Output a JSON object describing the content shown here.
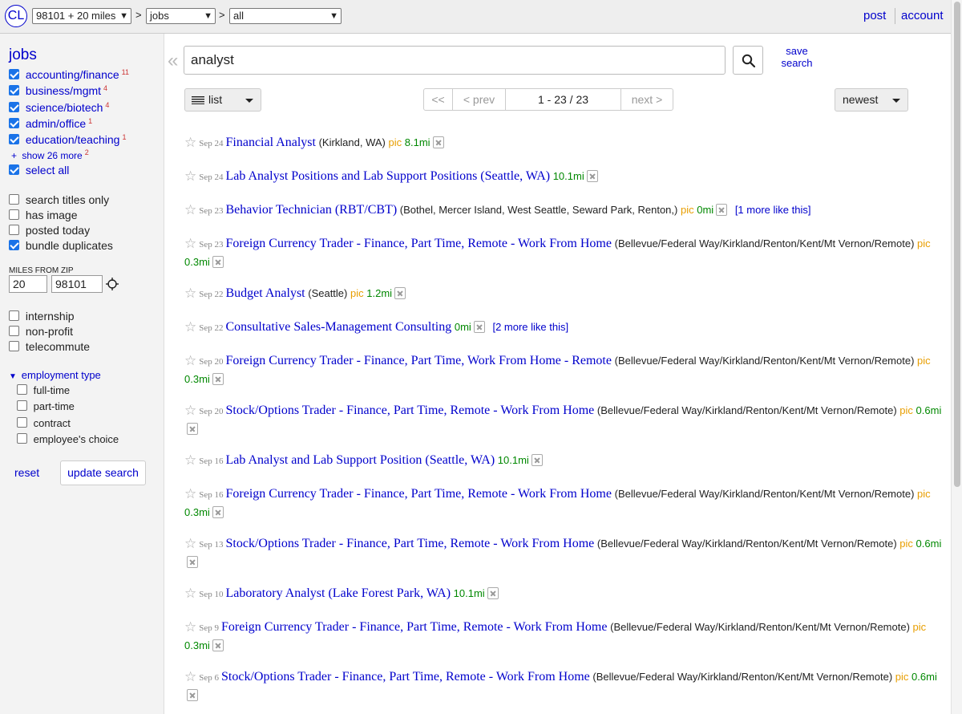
{
  "header": {
    "logo": "CL",
    "location_select": "98101 + 20 miles",
    "category_select": "jobs",
    "subcategory_select": "all",
    "separator": ">",
    "post": "post",
    "account": "account"
  },
  "sidebar": {
    "title": "jobs",
    "categories": [
      {
        "label": "accounting/finance",
        "count": "11",
        "checked": true
      },
      {
        "label": "business/mgmt",
        "count": "4",
        "checked": true
      },
      {
        "label": "science/biotech",
        "count": "4",
        "checked": true
      },
      {
        "label": "admin/office",
        "count": "1",
        "checked": true
      },
      {
        "label": "education/teaching",
        "count": "1",
        "checked": true
      }
    ],
    "show_more": "show 26 more",
    "show_more_count": "2",
    "select_all": "select all",
    "options": [
      {
        "label": "search titles only",
        "checked": false
      },
      {
        "label": "has image",
        "checked": false
      },
      {
        "label": "posted today",
        "checked": false
      },
      {
        "label": "bundle duplicates",
        "checked": true
      }
    ],
    "miles_label": "MILES FROM ZIP",
    "miles_value": "20",
    "zip_value": "98101",
    "extra_filters": [
      {
        "label": "internship",
        "checked": false
      },
      {
        "label": "non-profit",
        "checked": false
      },
      {
        "label": "telecommute",
        "checked": false
      }
    ],
    "employment_type_label": "employment type",
    "employment_types": [
      {
        "label": "full-time",
        "checked": false
      },
      {
        "label": "part-time",
        "checked": false
      },
      {
        "label": "contract",
        "checked": false
      },
      {
        "label": "employee's choice",
        "checked": false
      }
    ],
    "reset": "reset",
    "update_search": "update search"
  },
  "search": {
    "query": "analyst",
    "collapse_glyph": "«",
    "save_search": "save search"
  },
  "toolbar": {
    "view": "list",
    "first": "<<",
    "prev": "< prev",
    "range": "1 - 23 / 23",
    "next": "next >",
    "sort": "newest"
  },
  "results": [
    {
      "date": "Sep 24",
      "title": "Financial Analyst",
      "hood": "(Kirkland, WA)",
      "pic": "pic",
      "dist": "8.1mi",
      "more": ""
    },
    {
      "date": "Sep 24",
      "title": "Lab Analyst Positions and Lab Support Positions (Seattle, WA)",
      "hood": "",
      "pic": "",
      "dist": "10.1mi",
      "more": ""
    },
    {
      "date": "Sep 23",
      "title": "Behavior Technician (RBT/CBT)",
      "hood": "(Bothel, Mercer Island, West Seattle, Seward Park, Renton,)",
      "pic": "pic",
      "dist": "0mi",
      "more": "[1 more like this]"
    },
    {
      "date": "Sep 23",
      "title": "Foreign Currency Trader - Finance, Part Time, Remote - Work From Home",
      "hood": "(Bellevue/Federal Way/Kirkland/Renton/Kent/Mt Vernon/Remote)",
      "pic": "pic",
      "dist": "0.3mi",
      "more": ""
    },
    {
      "date": "Sep 22",
      "title": "Budget Analyst",
      "hood": "(Seattle)",
      "pic": "pic",
      "dist": "1.2mi",
      "more": ""
    },
    {
      "date": "Sep 22",
      "title": "Consultative Sales-Management Consulting",
      "hood": "",
      "pic": "",
      "dist": "0mi",
      "more": "[2 more like this]"
    },
    {
      "date": "Sep 20",
      "title": "Foreign Currency Trader - Finance, Part Time, Work From Home - Remote",
      "hood": "(Bellevue/Federal Way/Kirkland/Renton/Kent/Mt Vernon/Remote)",
      "pic": "pic",
      "dist": "0.3mi",
      "more": ""
    },
    {
      "date": "Sep 20",
      "title": "Stock/Options Trader - Finance, Part Time, Remote - Work From Home",
      "hood": "(Bellevue/Federal Way/Kirkland/Renton/Kent/Mt Vernon/Remote)",
      "pic": "pic",
      "dist": "0.6mi",
      "more": ""
    },
    {
      "date": "Sep 16",
      "title": "Lab Analyst and Lab Support Position (Seattle, WA)",
      "hood": "",
      "pic": "",
      "dist": "10.1mi",
      "more": ""
    },
    {
      "date": "Sep 16",
      "title": "Foreign Currency Trader - Finance, Part Time, Remote - Work From Home",
      "hood": "(Bellevue/Federal Way/Kirkland/Renton/Kent/Mt Vernon/Remote)",
      "pic": "pic",
      "dist": "0.3mi",
      "more": ""
    },
    {
      "date": "Sep 13",
      "title": "Stock/Options Trader - Finance, Part Time, Remote - Work From Home",
      "hood": "(Bellevue/Federal Way/Kirkland/Renton/Kent/Mt Vernon/Remote)",
      "pic": "pic",
      "dist": "0.6mi",
      "more": ""
    },
    {
      "date": "Sep 10",
      "title": "Laboratory Analyst (Lake Forest Park, WA)",
      "hood": "",
      "pic": "",
      "dist": "10.1mi",
      "more": ""
    },
    {
      "date": "Sep 9",
      "title": "Foreign Currency Trader - Finance, Part Time, Remote - Work From Home",
      "hood": "(Bellevue/Federal Way/Kirkland/Renton/Kent/Mt Vernon/Remote)",
      "pic": "pic",
      "dist": "0.3mi",
      "more": ""
    },
    {
      "date": "Sep 6",
      "title": "Stock/Options Trader - Finance, Part Time, Remote - Work From Home",
      "hood": "(Bellevue/Federal Way/Kirkland/Renton/Kent/Mt Vernon/Remote)",
      "pic": "pic",
      "dist": "0.6mi",
      "more": ""
    }
  ],
  "colors": {
    "link": "#0000cc",
    "pic": "#e89e00",
    "distance": "#008800",
    "count": "#cc3333",
    "checkbox": "#1a73e8"
  },
  "icons": {
    "star": "star-icon",
    "hide": "hide-posting-icon",
    "search": "magnifier-icon",
    "locate": "crosshair-icon",
    "list": "list-view-icon"
  }
}
